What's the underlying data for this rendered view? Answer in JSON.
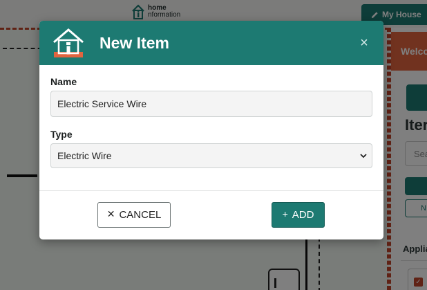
{
  "app": {
    "logo_line1": "home",
    "logo_line2": "nformation",
    "my_house_label": "My House",
    "side_panel": {
      "welcome_text": "Welco",
      "title_text": "Iter",
      "search_placeholder": "Sea",
      "outline_button_text": "N",
      "appliances_text": "Applia"
    }
  },
  "modal": {
    "title": "New Item",
    "close_symbol": "×",
    "name_label": "Name",
    "name_value": "Electric Service Wire",
    "type_label": "Type",
    "type_value": "Electric Wire",
    "cancel_icon": "✕",
    "cancel_label": "CANCEL",
    "add_icon": "+",
    "add_label": "ADD"
  },
  "colors": {
    "brand_teal": "#1d7a72",
    "accent_orange": "#e2643f",
    "dashed_border": "#c1442a"
  },
  "icons": [
    "home-info-logo-icon",
    "pencil-icon",
    "close-icon",
    "chevron-down-icon",
    "x-icon",
    "plus-icon",
    "checkbox-icon"
  ]
}
